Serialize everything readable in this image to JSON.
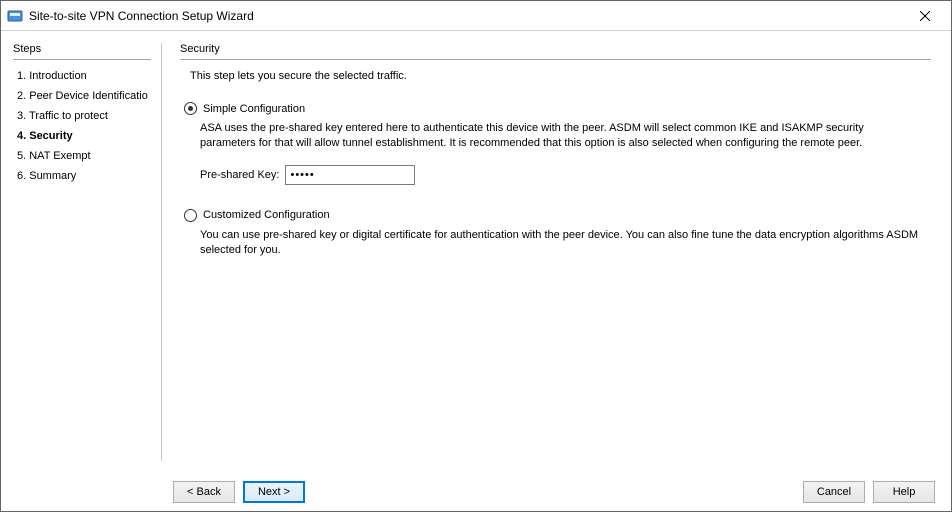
{
  "titlebar": {
    "text": "Site-to-site VPN Connection Setup Wizard"
  },
  "sidebar": {
    "heading": "Steps",
    "items": [
      {
        "label": "1. Introduction"
      },
      {
        "label": "2. Peer Device Identificatio"
      },
      {
        "label": "3. Traffic to protect"
      },
      {
        "label": "4. Security"
      },
      {
        "label": "5. NAT Exempt"
      },
      {
        "label": "6. Summary"
      }
    ]
  },
  "main": {
    "heading": "Security",
    "intro": "This step lets you secure the selected traffic.",
    "simple": {
      "label": "Simple Configuration",
      "desc": "ASA uses the pre-shared key entered here to authenticate this device with the peer. ASDM will select common IKE and ISAKMP security parameters for that will allow tunnel establishment. It is recommended that this option is also selected when configuring the remote peer.",
      "psk_label": "Pre-shared Key:",
      "psk_value": "•••••"
    },
    "custom": {
      "label": "Customized Configuration",
      "desc": "You can use pre-shared key or digital certificate for authentication with the peer device. You can also fine tune the data encryption algorithms ASDM selected for you."
    }
  },
  "footer": {
    "back": "< Back",
    "next": "Next >",
    "cancel": "Cancel",
    "help": "Help"
  }
}
